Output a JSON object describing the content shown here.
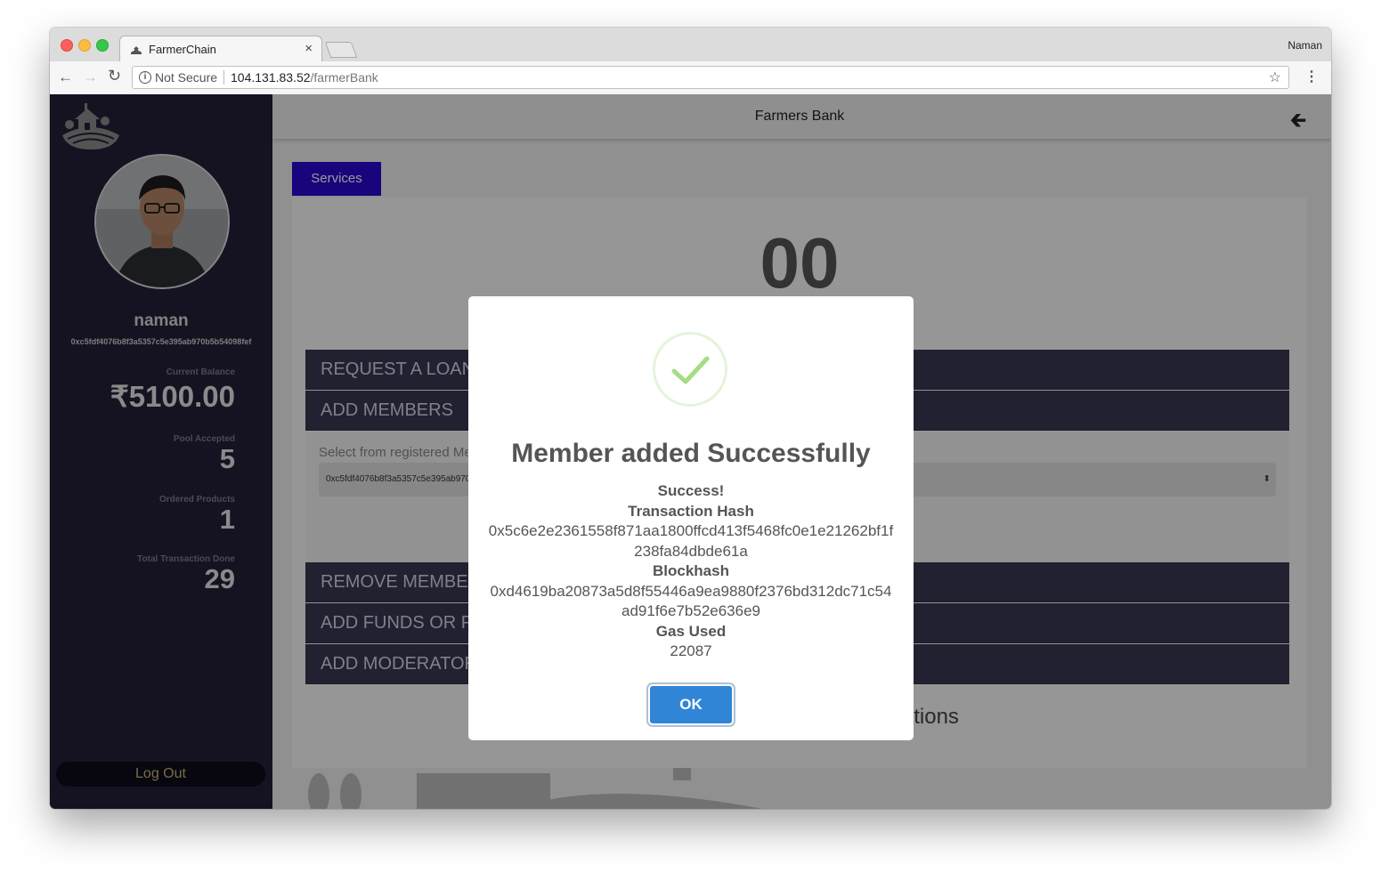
{
  "browser": {
    "tab_title": "FarmerChain",
    "tab_close": "×",
    "profile_name": "Naman",
    "not_secure": "Not Secure",
    "url_host": "104.131.83.52",
    "url_path": "/farmerBank",
    "back_glyph": "←",
    "forward_glyph": "→",
    "reload_glyph": "↻",
    "star_glyph": "☆",
    "menu_glyph": "⋮",
    "info_glyph": "i"
  },
  "sidebar": {
    "username": "naman",
    "address": "0xc5fdf4076b8f3a5357c5e395ab970b5b54098fef",
    "stats": [
      {
        "label": "Current Balance",
        "value": "₹5100.00"
      },
      {
        "label": "Pool Accepted",
        "value": "5"
      },
      {
        "label": "Ordered Products",
        "value": "1"
      },
      {
        "label": "Total Transaction Done",
        "value": "29"
      }
    ],
    "logout_label": "Log Out"
  },
  "header": {
    "title": "Farmers Bank",
    "back_glyph": "🡰"
  },
  "main": {
    "services_label": "Services",
    "balance_visible": "00",
    "accordion": [
      "REQUEST A LOAN",
      "ADD MEMBERS",
      "REMOVE MEMBER",
      "ADD FUNDS OR PAY",
      "ADD MODERATOR"
    ],
    "add_members": {
      "select_label": "Select from registered Members",
      "select_value": "0xc5fdf4076b8f3a5357c5e395ab970b5b54098fef",
      "select_arrow": "⬍"
    },
    "list_title": "List of All Blocks and Transactions"
  },
  "modal": {
    "title": "Member added Successfully",
    "success_label": "Success!",
    "tx_hash_label": "Transaction Hash",
    "tx_hash": "0x5c6e2e2361558f871aa1800ffcd413f5468fc0e1e21262bf1f238fa84dbde61a",
    "blockhash_label": "Blockhash",
    "blockhash": "0xd4619ba20873a5d8f55446a9ea9880f2376bd312dc71c54ad91f6e7b52e636e9",
    "gas_label": "Gas Used",
    "gas_value": "22087",
    "ok_label": "OK"
  },
  "colors": {
    "sidebar_bg": "#23213a",
    "services_button": "#2b07d1",
    "accordion_bg": "#3a3852",
    "ok_button": "#3085d6",
    "success_check": "#a5dc86"
  }
}
